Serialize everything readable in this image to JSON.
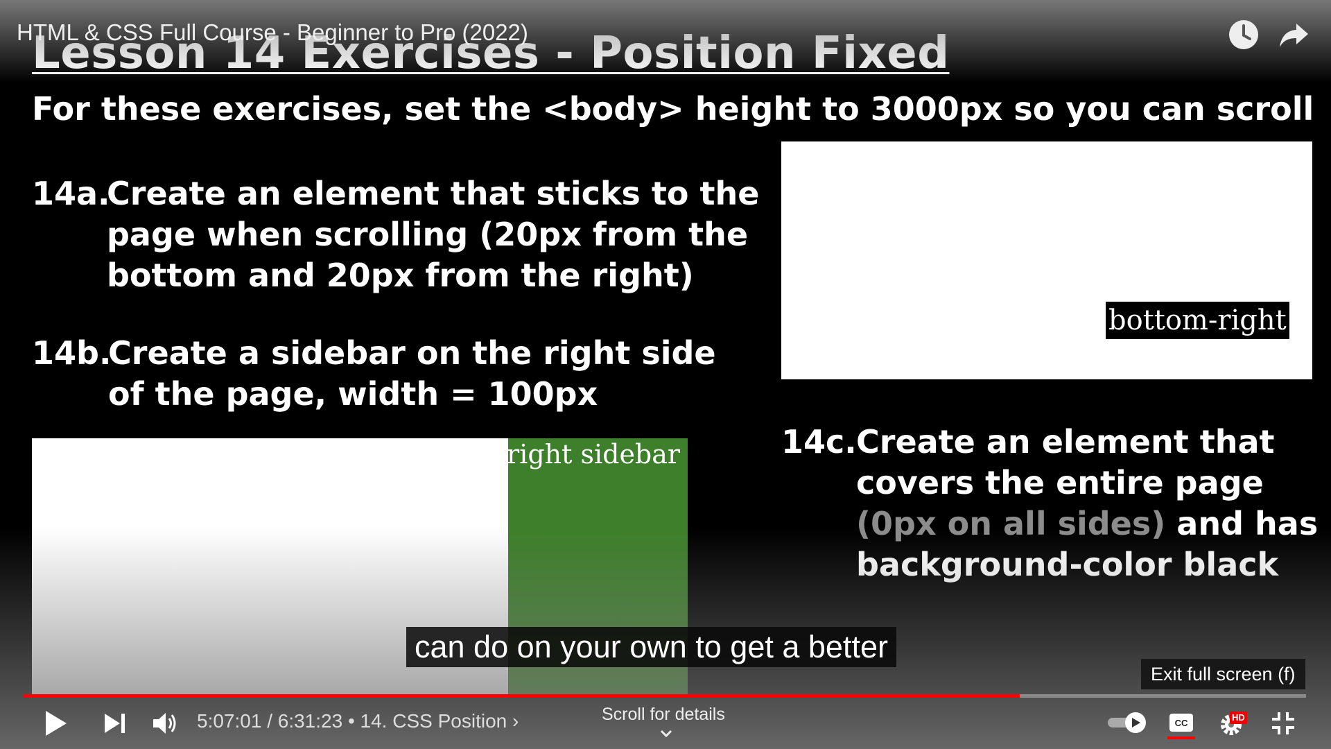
{
  "player": {
    "video_title": "HTML & CSS Full Course - Beginner to Pro (2022)",
    "caption": "can do on your own to get a better",
    "exit_fullscreen_tooltip": "Exit full screen (f)",
    "time_display": "5:07:01 / 6:31:23 • 14. CSS Position ›",
    "scroll_hint": "Scroll for details",
    "hd_badge": "HD",
    "progress_fraction": 0.777,
    "icons": {
      "watch_later": "clock-icon",
      "share": "share-arrow-icon",
      "play": "play-icon",
      "next": "next-icon",
      "volume": "volume-icon",
      "autoplay": "autoplay-toggle-icon",
      "captions": "cc-icon",
      "settings": "gear-icon",
      "exit_fullscreen": "exit-fullscreen-icon",
      "scroll": "chevron-down-icon"
    },
    "colors": {
      "progress": "#ff0000",
      "hd": "#ee0000"
    }
  },
  "slide": {
    "title": "Lesson 14 Exercises - Position Fixed",
    "intro": "For these exercises, set the <body> height to 3000px so you can scroll",
    "exercise_a": {
      "num": "14a.",
      "lines": [
        "Create an element that sticks to the",
        "page when scrolling (20px from the",
        "bottom and 20px from the right)"
      ]
    },
    "exercise_b": {
      "num": "14b.",
      "lines": [
        "Create a sidebar on the right side",
        "of the page, width = 100px"
      ]
    },
    "exercise_c": {
      "num": "14c.",
      "line1": "Create an element that",
      "line2": "covers the entire page",
      "line3_dim": "(0px on all sides)",
      "line3_rest": " and has",
      "line4": "background-color black"
    },
    "demo_bottom_right_label": "bottom-right",
    "demo_sidebar_label": "right sidebar",
    "colors": {
      "sidebar_green": "#3d7f2a"
    }
  }
}
